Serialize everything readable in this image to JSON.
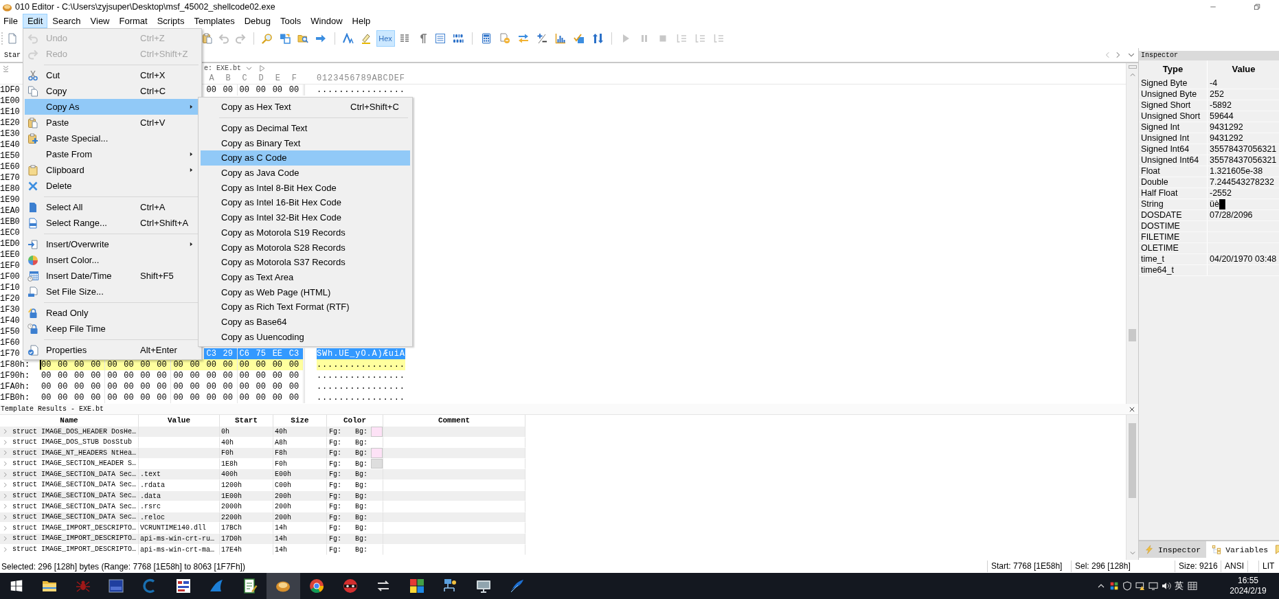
{
  "window": {
    "title": "010 Editor - C:\\Users\\zyjsuper\\Desktop\\msf_45002_shellcode02.exe"
  },
  "menu_bar": [
    {
      "label": "File",
      "selected": false
    },
    {
      "label": "Edit",
      "selected": true
    },
    {
      "label": "Search",
      "selected": false
    },
    {
      "label": "View",
      "selected": false
    },
    {
      "label": "Format",
      "selected": false
    },
    {
      "label": "Scripts",
      "selected": false
    },
    {
      "label": "Templates",
      "selected": false
    },
    {
      "label": "Debug",
      "selected": false
    },
    {
      "label": "Tools",
      "selected": false
    },
    {
      "label": "Window",
      "selected": false
    },
    {
      "label": "Help",
      "selected": false
    }
  ],
  "toolbar": [
    {
      "kind": "button",
      "disabled": false
    },
    {
      "kind": "button",
      "disabled": false
    },
    {
      "kind": "button",
      "disabled": true
    },
    {
      "kind": "button",
      "disabled": true
    },
    {
      "kind": "separator"
    },
    {
      "kind": "button",
      "disabled": false
    },
    {
      "kind": "button",
      "disabled": false
    },
    {
      "kind": "button",
      "disabled": false
    },
    {
      "kind": "button",
      "disabled": false
    },
    {
      "kind": "separator"
    },
    {
      "kind": "button",
      "disabled": false
    },
    {
      "kind": "button",
      "disabled": false
    },
    {
      "kind": "toggle",
      "label": "Hex",
      "selected": true
    },
    {
      "kind": "button",
      "disabled": false
    },
    {
      "kind": "button",
      "disabled": false
    },
    {
      "kind": "button",
      "disabled": false
    },
    {
      "kind": "button",
      "disabled": false
    },
    {
      "kind": "separator"
    },
    {
      "kind": "button",
      "disabled": false
    },
    {
      "kind": "button",
      "disabled": false
    },
    {
      "kind": "button",
      "disabled": false
    },
    {
      "kind": "button",
      "disabled": false
    },
    {
      "kind": "button",
      "disabled": false
    },
    {
      "kind": "button",
      "disabled": false
    },
    {
      "kind": "button",
      "disabled": false
    },
    {
      "kind": "separator"
    },
    {
      "kind": "button",
      "disabled": true
    },
    {
      "kind": "button",
      "disabled": true
    },
    {
      "kind": "button",
      "disabled": true
    },
    {
      "kind": "button",
      "disabled": true
    },
    {
      "kind": "button",
      "disabled": true
    },
    {
      "kind": "button",
      "disabled": true
    }
  ],
  "editor_tabs": [
    {
      "label": "Star",
      "selected": true
    }
  ],
  "template_bar": {
    "label": "e:",
    "template": "EXE.bt"
  },
  "hex_view": {
    "column_headers": [
      "A",
      "B",
      "C",
      "D",
      "E",
      "F"
    ],
    "ascii_header": "0123456789ABCDEF",
    "rows": [
      {
        "address": "1DF0",
        "bytes": [
          "00",
          "00",
          "00",
          "00",
          "00",
          "00"
        ],
        "ascii": "................",
        "selected": false,
        "current": false
      },
      {
        "address": "1E00"
      },
      {
        "address": "1E10"
      },
      {
        "address": "1E20"
      },
      {
        "address": "1E30"
      },
      {
        "address": "1E40"
      },
      {
        "address": "1E50"
      },
      {
        "address": "1E60"
      },
      {
        "address": "1E70"
      },
      {
        "address": "1E80"
      },
      {
        "address": "1E90"
      },
      {
        "address": "1EA0"
      },
      {
        "address": "1EB0"
      },
      {
        "address": "1EC0"
      },
      {
        "address": "1ED0"
      },
      {
        "address": "1EE0"
      },
      {
        "address": "1EF0"
      },
      {
        "address": "1F00"
      },
      {
        "address": "1F10"
      },
      {
        "address": "1F20"
      },
      {
        "address": "1F30"
      },
      {
        "address": "1F40"
      },
      {
        "address": "1F50"
      },
      {
        "address": "1F60"
      },
      {
        "address": "1F70",
        "bytes": [
          "C3",
          "29",
          "C6",
          "75",
          "EE",
          "C3"
        ],
        "ascii": "SWh.UE_yO.A)ÆuiA",
        "selected": true,
        "current": false
      },
      {
        "address": "1F80h:",
        "bytes": [
          "00",
          "00",
          "00",
          "00",
          "00",
          "00",
          "00",
          "00",
          "00",
          "00",
          "00",
          "00",
          "00",
          "00",
          "00",
          "00"
        ],
        "ascii": "................",
        "selected": false,
        "current": true
      },
      {
        "address": "1F90h:",
        "bytes": [
          "00",
          "00",
          "00",
          "00",
          "00",
          "00",
          "00",
          "00",
          "00",
          "00",
          "00",
          "00",
          "00",
          "00",
          "00",
          "00"
        ],
        "ascii": "................",
        "selected": false,
        "current": false
      },
      {
        "address": "1FA0h:",
        "bytes": [
          "00",
          "00",
          "00",
          "00",
          "00",
          "00",
          "00",
          "00",
          "00",
          "00",
          "00",
          "00",
          "00",
          "00",
          "00",
          "00"
        ],
        "ascii": "................",
        "selected": false,
        "current": false
      },
      {
        "address": "1FB0h:",
        "bytes": [
          "00",
          "00",
          "00",
          "00",
          "00",
          "00",
          "00",
          "00",
          "00",
          "00",
          "00",
          "00",
          "00",
          "00",
          "00",
          "00"
        ],
        "ascii": "................",
        "selected": false,
        "current": false
      }
    ]
  },
  "edit_menu": {
    "items": [
      {
        "kind": "item",
        "label": "Undo",
        "shortcut": "Ctrl+Z",
        "submenu": false,
        "disabled": true,
        "selected": false
      },
      {
        "kind": "item",
        "label": "Redo",
        "shortcut": "Ctrl+Shift+Z",
        "submenu": false,
        "disabled": true,
        "selected": false
      },
      {
        "kind": "separator"
      },
      {
        "kind": "item",
        "label": "Cut",
        "shortcut": "Ctrl+X",
        "submenu": false,
        "disabled": false,
        "selected": false
      },
      {
        "kind": "item",
        "label": "Copy",
        "shortcut": "Ctrl+C",
        "submenu": false,
        "disabled": false,
        "selected": false
      },
      {
        "kind": "item",
        "label": "Copy As",
        "submenu": true,
        "disabled": false,
        "selected": true
      },
      {
        "kind": "item",
        "label": "Paste",
        "shortcut": "Ctrl+V",
        "submenu": false,
        "disabled": false,
        "selected": false
      },
      {
        "kind": "item",
        "label": "Paste Special...",
        "submenu": false,
        "disabled": false,
        "selected": false
      },
      {
        "kind": "item",
        "label": "Paste From",
        "submenu": true,
        "disabled": false,
        "selected": false
      },
      {
        "kind": "item",
        "label": "Clipboard",
        "submenu": true,
        "disabled": false,
        "selected": false
      },
      {
        "kind": "item",
        "label": "Delete",
        "submenu": false,
        "disabled": false,
        "selected": false
      },
      {
        "kind": "separator"
      },
      {
        "kind": "item",
        "label": "Select All",
        "shortcut": "Ctrl+A",
        "submenu": false,
        "disabled": false,
        "selected": false
      },
      {
        "kind": "item",
        "label": "Select Range...",
        "shortcut": "Ctrl+Shift+A",
        "submenu": false,
        "disabled": false,
        "selected": false
      },
      {
        "kind": "separator"
      },
      {
        "kind": "item",
        "label": "Insert/Overwrite",
        "submenu": true,
        "disabled": false,
        "selected": false
      },
      {
        "kind": "item",
        "label": "Insert Color...",
        "submenu": false,
        "disabled": false,
        "selected": false
      },
      {
        "kind": "item",
        "label": "Insert Date/Time",
        "shortcut": "Shift+F5",
        "submenu": false,
        "disabled": false,
        "selected": false
      },
      {
        "kind": "item",
        "label": "Set File Size...",
        "submenu": false,
        "disabled": false,
        "selected": false
      },
      {
        "kind": "separator"
      },
      {
        "kind": "item",
        "label": "Read Only",
        "submenu": false,
        "disabled": false,
        "selected": false
      },
      {
        "kind": "item",
        "label": "Keep File Time",
        "submenu": false,
        "disabled": false,
        "selected": false
      },
      {
        "kind": "separator"
      },
      {
        "kind": "item",
        "label": "Properties",
        "shortcut": "Alt+Enter",
        "submenu": false,
        "disabled": false,
        "selected": false
      }
    ]
  },
  "copy_as_menu": {
    "items": [
      {
        "kind": "item",
        "label": "Copy as Hex Text",
        "shortcut": "Ctrl+Shift+C",
        "selected": false
      },
      {
        "kind": "separator"
      },
      {
        "kind": "item",
        "label": "Copy as Decimal Text",
        "selected": false
      },
      {
        "kind": "item",
        "label": "Copy as Binary Text",
        "selected": false
      },
      {
        "kind": "item",
        "label": "Copy as C Code",
        "selected": true
      },
      {
        "kind": "item",
        "label": "Copy as Java Code",
        "selected": false
      },
      {
        "kind": "item",
        "label": "Copy as Intel 8-Bit Hex Code",
        "selected": false
      },
      {
        "kind": "item",
        "label": "Copy as Intel 16-Bit Hex Code",
        "selected": false
      },
      {
        "kind": "item",
        "label": "Copy as Intel 32-Bit Hex Code",
        "selected": false
      },
      {
        "kind": "item",
        "label": "Copy as Motorola S19 Records",
        "selected": false
      },
      {
        "kind": "item",
        "label": "Copy as Motorola S28 Records",
        "selected": false
      },
      {
        "kind": "item",
        "label": "Copy as Motorola S37 Records",
        "selected": false
      },
      {
        "kind": "item",
        "label": "Copy as Text Area",
        "selected": false
      },
      {
        "kind": "item",
        "label": "Copy as Web Page (HTML)",
        "selected": false
      },
      {
        "kind": "item",
        "label": "Copy as Rich Text Format (RTF)",
        "selected": false
      },
      {
        "kind": "item",
        "label": "Copy as Base64",
        "selected": false
      },
      {
        "kind": "item",
        "label": "Copy as Uuencoding",
        "selected": false
      }
    ]
  },
  "template_results": {
    "title": "Template Results - EXE.bt",
    "columns": [
      "Name",
      "Value",
      "Start",
      "Size",
      "Color",
      "Comment"
    ],
    "rows": [
      {
        "name": "struct IMAGE_DOS_HEADER DosHe…",
        "start": "0h",
        "size": "40h",
        "fg": "Fg:",
        "bg": "Bg:",
        "color": "#fde2f6"
      },
      {
        "name": "struct IMAGE_DOS_STUB DosStub",
        "start": "40h",
        "size": "A8h",
        "fg": "Fg:",
        "bg": "Bg:"
      },
      {
        "name": "struct IMAGE_NT_HEADERS NtHea…",
        "start": "F0h",
        "size": "F8h",
        "fg": "Fg:",
        "bg": "Bg:",
        "color": "#fde2f6"
      },
      {
        "name": "struct IMAGE_SECTION_HEADER S…",
        "start": "1E8h",
        "size": "F0h",
        "fg": "Fg:",
        "bg": "Bg:",
        "color": "#dedede"
      },
      {
        "name": "struct IMAGE_SECTION_DATA Sec…",
        "value": ".text",
        "start": "400h",
        "size": "E00h",
        "fg": "Fg:",
        "bg": "Bg:"
      },
      {
        "name": "struct IMAGE_SECTION_DATA Sec…",
        "value": ".rdata",
        "start": "1200h",
        "size": "C00h",
        "fg": "Fg:",
        "bg": "Bg:"
      },
      {
        "name": "struct IMAGE_SECTION_DATA Sec…",
        "value": ".data",
        "start": "1E00h",
        "size": "200h",
        "fg": "Fg:",
        "bg": "Bg:"
      },
      {
        "name": "struct IMAGE_SECTION_DATA Sec…",
        "value": ".rsrc",
        "start": "2000h",
        "size": "200h",
        "fg": "Fg:",
        "bg": "Bg:"
      },
      {
        "name": "struct IMAGE_SECTION_DATA Sec…",
        "value": ".reloc",
        "start": "2200h",
        "size": "200h",
        "fg": "Fg:",
        "bg": "Bg:"
      },
      {
        "name": "struct IMAGE_IMPORT_DESCRIPTO…",
        "value": "VCRUNTIME140.dll",
        "start": "17BCh",
        "size": "14h",
        "fg": "Fg:",
        "bg": "Bg:"
      },
      {
        "name": "struct IMAGE_IMPORT_DESCRIPTO…",
        "value": "api-ms-win-crt-ru…",
        "start": "17D0h",
        "size": "14h",
        "fg": "Fg:",
        "bg": "Bg:"
      },
      {
        "name": "struct IMAGE_IMPORT_DESCRIPTO…",
        "value": "api-ms-win-crt-ma…",
        "start": "17E4h",
        "size": "14h",
        "fg": "Fg:",
        "bg": "Bg:"
      }
    ]
  },
  "inspector": {
    "title": "Inspector",
    "columns": [
      "Type",
      "Value"
    ],
    "rows": [
      {
        "type": "Signed Byte",
        "value": "-4"
      },
      {
        "type": "Unsigned Byte",
        "value": "252"
      },
      {
        "type": "Signed Short",
        "value": "-5892"
      },
      {
        "type": "Unsigned Short",
        "value": "59644"
      },
      {
        "type": "Signed Int",
        "value": "9431292"
      },
      {
        "type": "Unsigned Int",
        "value": "9431292"
      },
      {
        "type": "Signed Int64",
        "value": "35578437056321"
      },
      {
        "type": "Unsigned Int64",
        "value": "35578437056321"
      },
      {
        "type": "Float",
        "value": "1.321605e-38"
      },
      {
        "type": "Double",
        "value": "7.244543278232"
      },
      {
        "type": "Half Float",
        "value": "-2552"
      },
      {
        "type": "String",
        "value": "üè█"
      },
      {
        "type": "DOSDATE",
        "value": "07/28/2096"
      },
      {
        "type": "DOSTIME"
      },
      {
        "type": "FILETIME"
      },
      {
        "type": "OLETIME"
      },
      {
        "type": "time_t",
        "value": "04/20/1970 03:48"
      },
      {
        "type": "time64_t"
      }
    ],
    "tabs": [
      {
        "label": "Inspector",
        "selected": true
      },
      {
        "label": "Variables",
        "selected": false
      }
    ]
  },
  "status_bar": {
    "message": "Selected: 296 [128h] bytes (Range: 7768 [1E58h] to 8063 [1F7Fh])",
    "cells": [
      "Start: 7768 [1E58h]",
      "Sel: 296 [128h]",
      "Size: 9216",
      "ANSI",
      "LIT"
    ]
  },
  "taskbar": {
    "apps": [
      {
        "selected": false
      },
      {
        "selected": false
      },
      {
        "selected": false
      },
      {
        "selected": false
      },
      {
        "selected": false
      },
      {
        "selected": false
      },
      {
        "selected": false
      },
      {
        "selected": true
      },
      {
        "selected": false
      },
      {
        "selected": false
      },
      {
        "selected": false
      },
      {
        "selected": false
      },
      {
        "selected": false
      },
      {
        "selected": false
      },
      {
        "selected": false
      }
    ],
    "ime": "英",
    "time": "16:55",
    "date": "2024/2/19"
  }
}
